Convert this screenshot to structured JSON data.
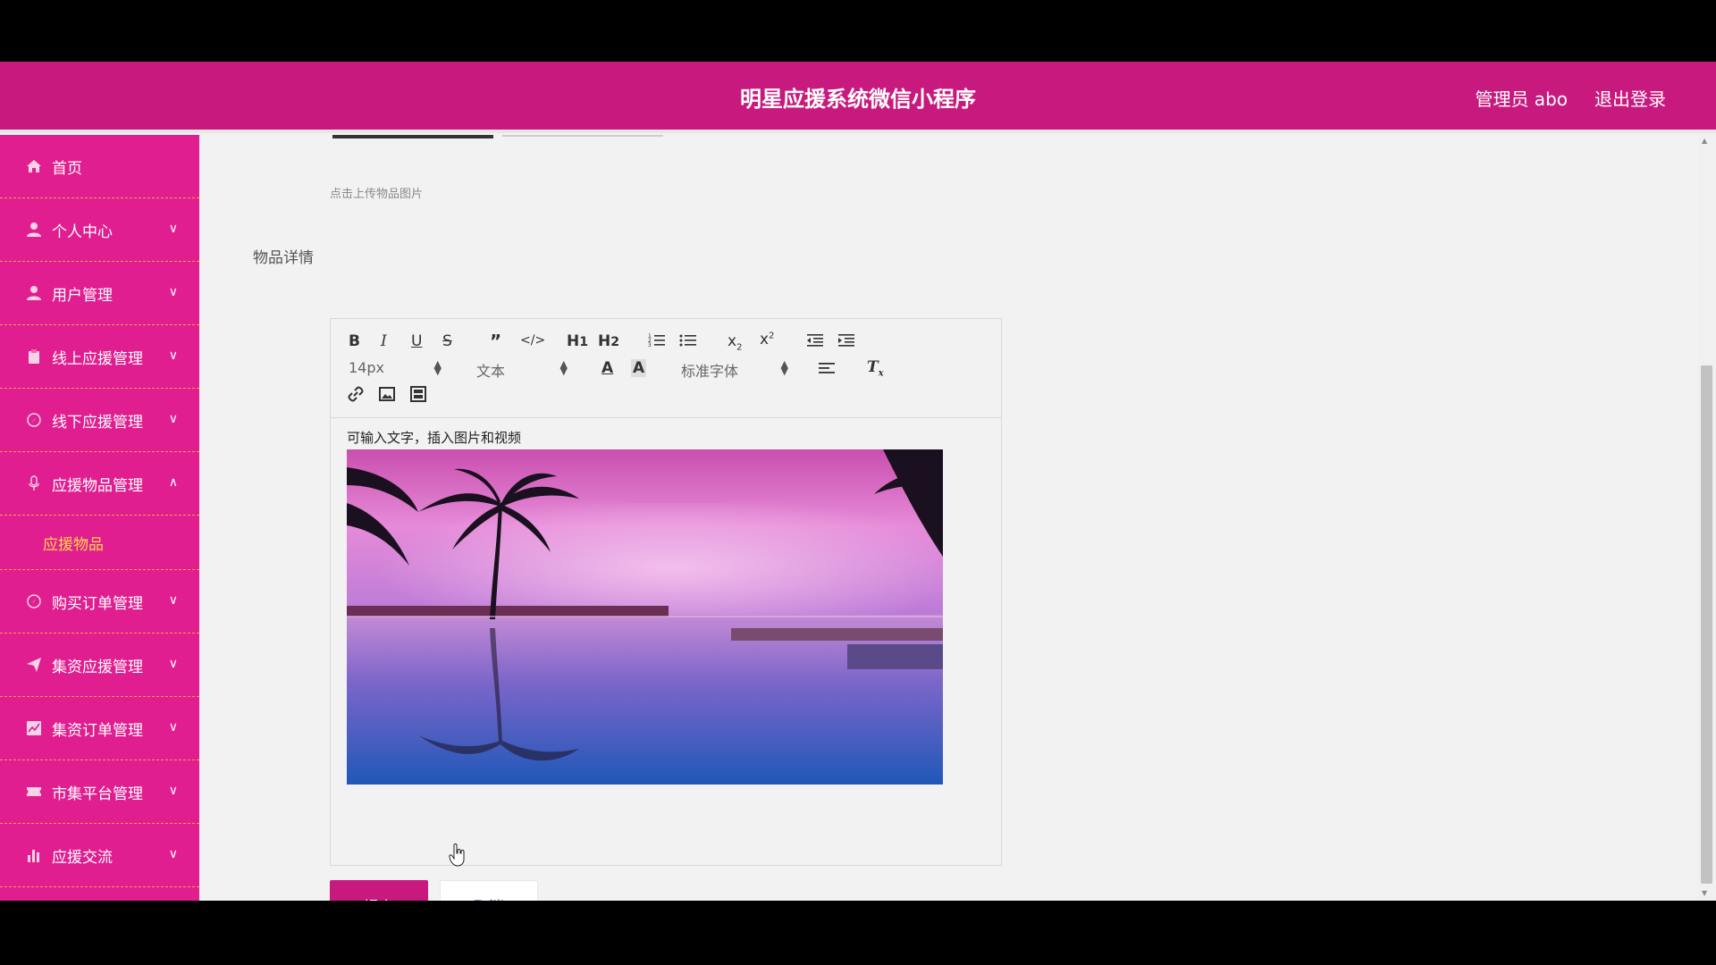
{
  "header": {
    "title": "明星应援系统微信小程序",
    "user_label": "管理员 abo",
    "logout_label": "退出登录"
  },
  "sidebar": {
    "items": [
      {
        "label": "首页",
        "icon": "home-icon",
        "expandable": false
      },
      {
        "label": "个人中心",
        "icon": "user-icon",
        "expandable": true
      },
      {
        "label": "用户管理",
        "icon": "user-icon",
        "expandable": true
      },
      {
        "label": "线上应援管理",
        "icon": "clipboard-icon",
        "expandable": true
      },
      {
        "label": "线下应援管理",
        "icon": "compass-icon",
        "expandable": true
      },
      {
        "label": "应援物品管理",
        "icon": "microphone-icon",
        "expandable": true,
        "expanded": true
      },
      {
        "label": "购买订单管理",
        "icon": "compass-icon",
        "expandable": true
      },
      {
        "label": "集资应援管理",
        "icon": "paper-plane-icon",
        "expandable": true
      },
      {
        "label": "集资订单管理",
        "icon": "chart-icon",
        "expandable": true
      },
      {
        "label": "市集平台管理",
        "icon": "ticket-icon",
        "expandable": true
      },
      {
        "label": "应援交流",
        "icon": "bar-chart-icon",
        "expandable": true
      }
    ],
    "submenu_active": "应援物品"
  },
  "form": {
    "upload_hint": "点击上传物品图片",
    "detail_label": "物品详情",
    "editor": {
      "font_size": "14px",
      "header_style": "文本",
      "font_family": "标准字体",
      "content_text": "可输入文字，插入图片和视频"
    },
    "submit_label": "提交",
    "cancel_label": "取消"
  },
  "colors": {
    "header": "#c81a7e",
    "sidebar": "#e11e8f",
    "submenu_active": "#ffd84a",
    "divider": "#f0a04b"
  }
}
